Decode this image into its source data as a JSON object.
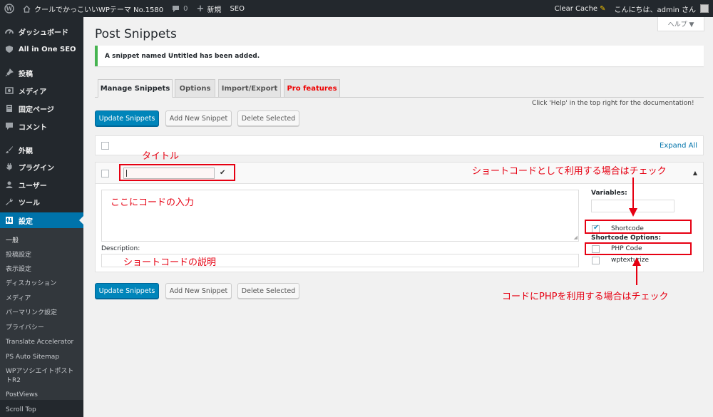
{
  "admin_bar": {
    "site_name": "クールでかっこいいWPテーマ No.1580",
    "comments_count": "0",
    "new_label": "新規",
    "seo_label": "SEO",
    "clear_cache": "Clear Cache",
    "greeting": "こんにちは、admin さん"
  },
  "sidebar": {
    "menu": [
      {
        "label": "ダッシュボード",
        "icon": "dashboard-icon"
      },
      {
        "label": "All in One SEO",
        "icon": "shield-icon"
      },
      {
        "label": "投稿",
        "icon": "pin-icon"
      },
      {
        "label": "メディア",
        "icon": "media-icon"
      },
      {
        "label": "固定ページ",
        "icon": "page-icon"
      },
      {
        "label": "コメント",
        "icon": "comment-icon"
      },
      {
        "label": "外観",
        "icon": "brush-icon"
      },
      {
        "label": "プラグイン",
        "icon": "plug-icon"
      },
      {
        "label": "ユーザー",
        "icon": "user-icon"
      },
      {
        "label": "ツール",
        "icon": "wrench-icon"
      },
      {
        "label": "設定",
        "icon": "settings-icon"
      }
    ],
    "submenu": [
      "一般",
      "投稿設定",
      "表示設定",
      "ディスカッション",
      "メディア",
      "パーマリンク設定",
      "プライバシー",
      "Translate Accelerator",
      "PS Auto Sitemap",
      "WPアソシエイトポスト",
      "トR2",
      "PostViews",
      "Scroll Top"
    ]
  },
  "page": {
    "title": "Post Snippets",
    "help_label": "ヘルプ ▼",
    "notice": "A snippet named Untitled has been added.",
    "tabs": [
      {
        "label": "Manage Snippets"
      },
      {
        "label": "Options"
      },
      {
        "label": "Import/Export"
      },
      {
        "label": "Pro features"
      }
    ],
    "help_text": "Click 'Help' in the top right for the documentation!",
    "buttons": {
      "update": "Update Snippets",
      "add": "Add New Snippet",
      "delete": "Delete Selected"
    },
    "expand_all": "Expand All",
    "snippet": {
      "title_value": "",
      "save_mark": "✔",
      "toggle_arrow": "▲",
      "variables_label": "Variables:",
      "shortcode_label": "Shortcode",
      "shortcode_options_label": "Shortcode Options:",
      "php_code_label": "PHP Code",
      "wptexturize_label": "wptexturize",
      "description_label": "Description:",
      "shortcode_checked": true
    }
  },
  "annotations": {
    "title_note": "タイトル",
    "code_note": "ここにコードの入力",
    "desc_note": "ショートコードの説明",
    "shortcode_note": "ショートコードとして利用する場合はチェック",
    "php_note": "コードにPHPを利用する場合はチェック",
    "color": "#e60012"
  },
  "colors": {
    "admin_bar": "#23282d",
    "accent": "#0073aa",
    "primary_button": "#0085ba",
    "notice_success": "#46b450"
  }
}
